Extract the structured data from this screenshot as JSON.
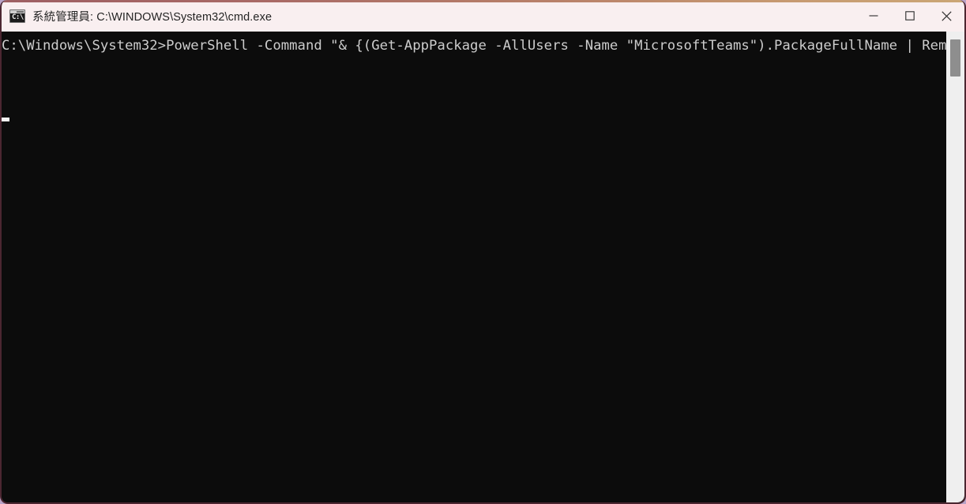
{
  "window": {
    "title": "系統管理員: C:\\WINDOWS\\System32\\cmd.exe",
    "icon_name": "cmd-console-icon",
    "icon_glyph": "C:\\",
    "colors": {
      "titlebar_bg": "#f9eff0",
      "console_bg": "#0c0c0c",
      "console_fg": "#cccccc",
      "border": "#4c2731",
      "accent_left": "#9e5f63",
      "accent_right": "#cba675",
      "desktop_bg": "#b9a3c8",
      "scrollbar_track": "#efefef",
      "scrollbar_thumb": "#8e8e8e"
    }
  },
  "controls": {
    "minimize_label": "最小化",
    "maximize_label": "最大化",
    "close_label": "關閉"
  },
  "console": {
    "lines": [
      "C:\\Windows\\System32>PowerShell -Command \"& {(Get-AppPackage -AllUsers -Name \"MicrosoftTeams\").PackageFullName | Remove-AppPackage -AllUsers}\""
    ],
    "rendered_text": "C:\\Windows\\System32>PowerShell -Command \"& {(Get-AppPackage -AllUsers -Name \"MicrosoftTeams\").PackageFullName | Remove-AppPackage -AllUsers}\"",
    "prompt_path": "C:\\Windows\\System32>",
    "command": "PowerShell -Command \"& {(Get-AppPackage -AllUsers -Name \"MicrosoftTeams\").PackageFullName | Remove-AppPackage -AllUsers}\"",
    "caret_visible": true
  },
  "scrollbar": {
    "orientation": "vertical",
    "thumb_position": "near-top"
  }
}
